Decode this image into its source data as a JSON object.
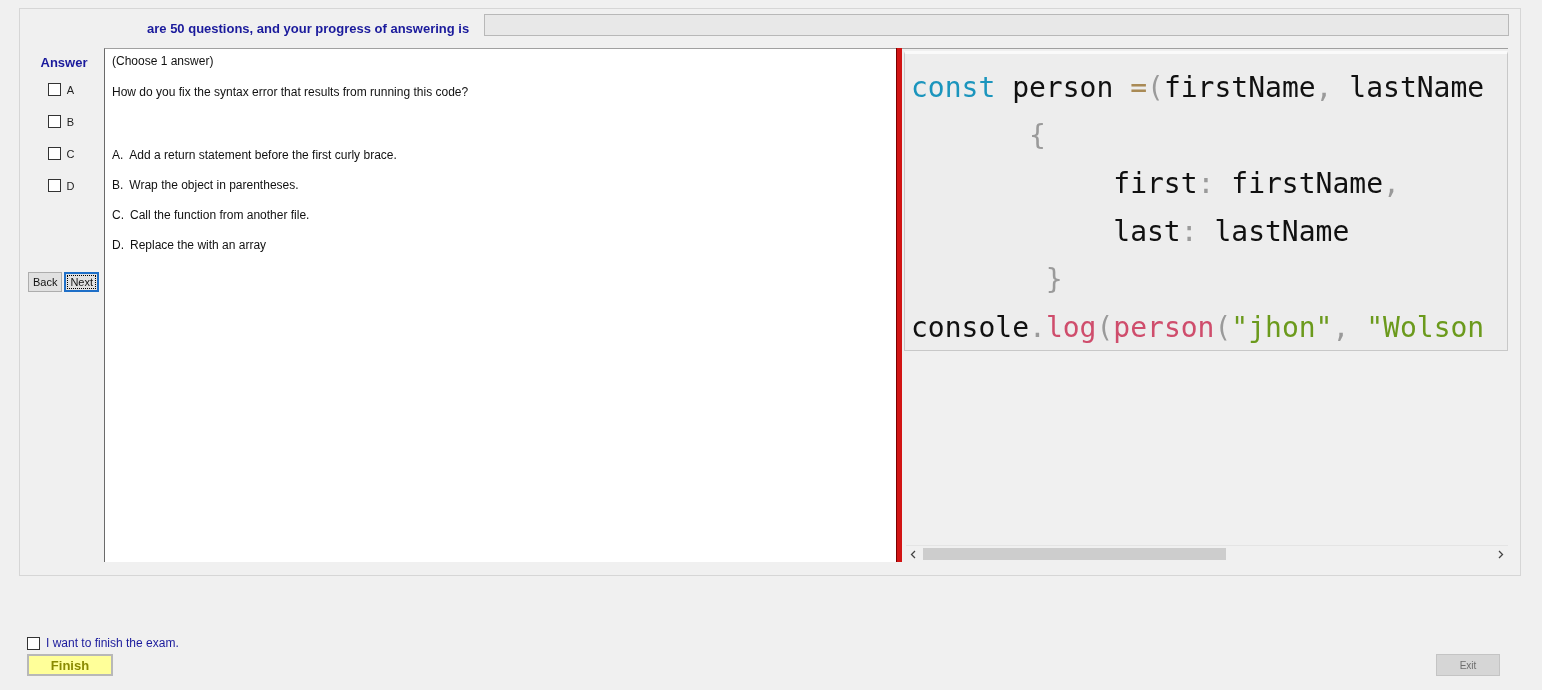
{
  "header": {
    "text": "are 50 questions, and your progress of answering is",
    "progress": {
      "level": 0
    }
  },
  "answer_panel": {
    "title": "Answer",
    "options": [
      {
        "label": "A",
        "checked": false
      },
      {
        "label": "B",
        "checked": false
      },
      {
        "label": "C",
        "checked": false
      },
      {
        "label": "D",
        "checked": false
      }
    ],
    "buttons": [
      {
        "label": "Back",
        "focused": false
      },
      {
        "label": "Next",
        "focused": true
      }
    ]
  },
  "question": {
    "instruction": "(Choose 1 answer)",
    "text": "How do you fix the syntax error that results from running this code?",
    "choices": [
      {
        "letter": "A.",
        "text": "Add a return statement before the first curly brace."
      },
      {
        "letter": "B.",
        "text": "Wrap the object in parentheses."
      },
      {
        "letter": "C.",
        "text": "Call the function from another file."
      },
      {
        "letter": "D.",
        "text": "Replace the with an array"
      }
    ]
  },
  "code": {
    "lines": [
      [
        {
          "kind": "keyword",
          "text": "const"
        },
        {
          "kind": "plain",
          "text": " person "
        },
        {
          "kind": "operator",
          "text": "="
        },
        {
          "kind": "punct",
          "text": "("
        },
        {
          "kind": "plain",
          "text": "firstName"
        },
        {
          "kind": "punct",
          "text": ", "
        },
        {
          "kind": "plain",
          "text": "lastName"
        }
      ],
      [
        {
          "kind": "punct",
          "text": "       {"
        }
      ],
      [
        {
          "kind": "plain",
          "text": "            first"
        },
        {
          "kind": "punct",
          "text": ": "
        },
        {
          "kind": "plain",
          "text": "firstName"
        },
        {
          "kind": "punct",
          "text": ","
        }
      ],
      [
        {
          "kind": "plain",
          "text": "            last"
        },
        {
          "kind": "punct",
          "text": ": "
        },
        {
          "kind": "plain",
          "text": "lastName"
        }
      ],
      [
        {
          "kind": "punct",
          "text": "        }"
        }
      ],
      [
        {
          "kind": "plain",
          "text": "console"
        },
        {
          "kind": "punct",
          "text": "."
        },
        {
          "kind": "func",
          "text": "log"
        },
        {
          "kind": "punct",
          "text": "("
        },
        {
          "kind": "func",
          "text": "person"
        },
        {
          "kind": "punct",
          "text": "("
        },
        {
          "kind": "string",
          "text": "\"jhon\""
        },
        {
          "kind": "punct",
          "text": ", "
        },
        {
          "kind": "string",
          "text": "\"Wolson"
        }
      ]
    ]
  },
  "footer": {
    "finish_check": {
      "label": "I want to finish the exam.",
      "checked": false
    },
    "finish_button": {
      "label": "Finish"
    },
    "exit_button": {
      "label": "Exit",
      "disabled": true
    }
  }
}
